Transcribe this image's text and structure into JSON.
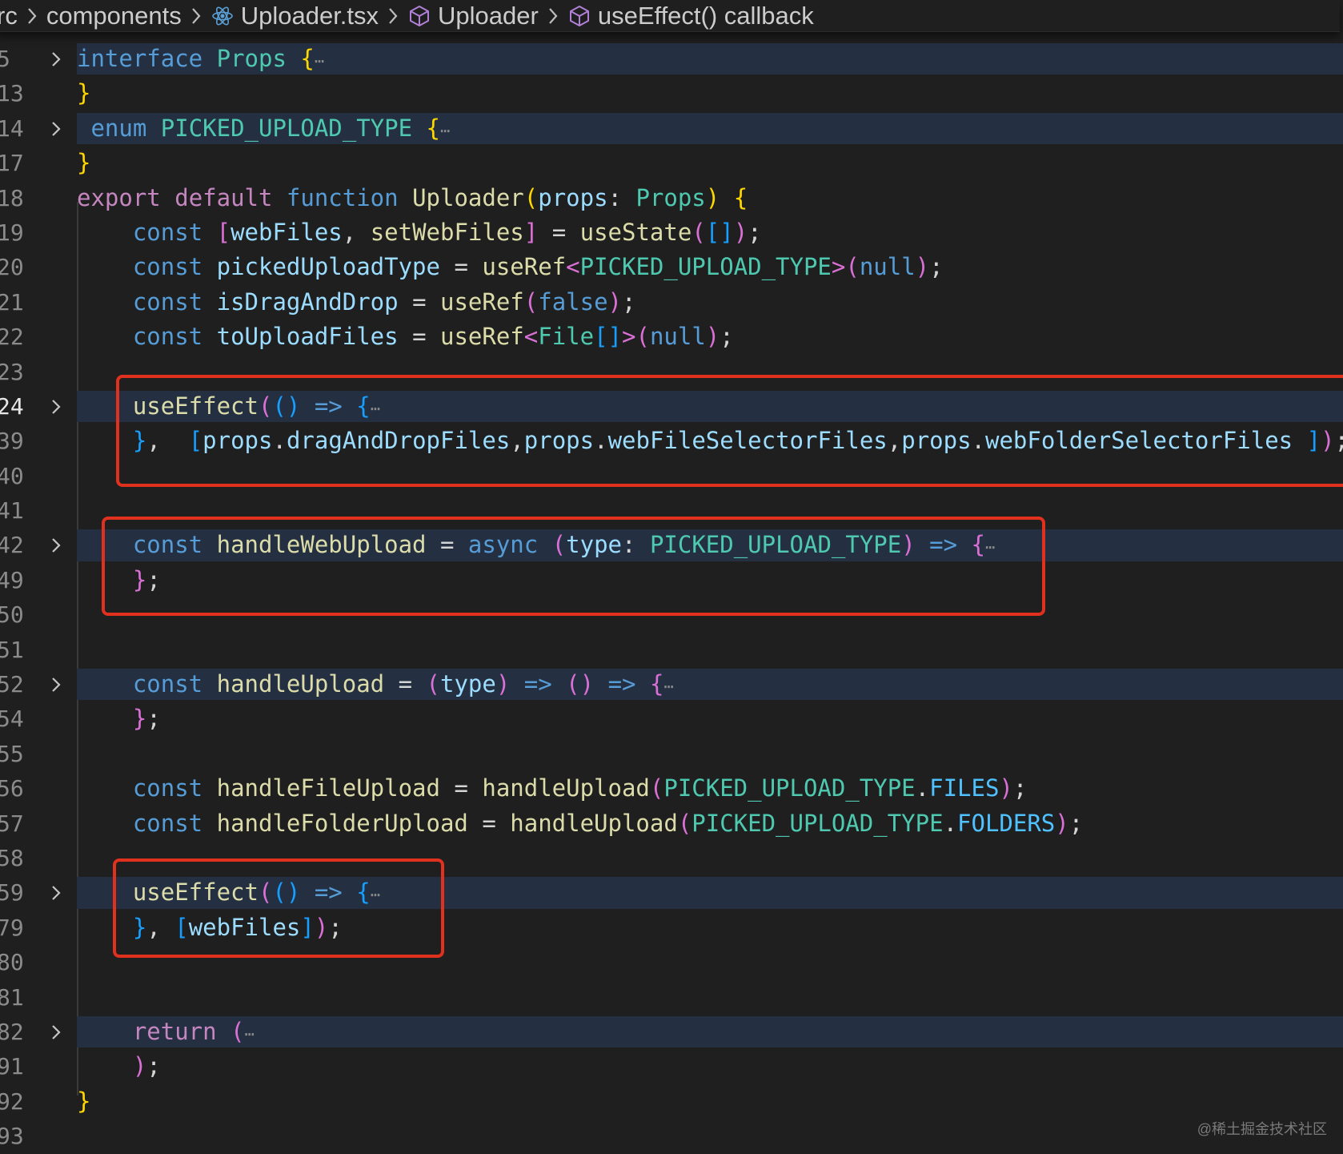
{
  "breadcrumb": {
    "items": [
      {
        "label": "rc",
        "icon": ""
      },
      {
        "label": "components",
        "icon": ""
      },
      {
        "label": "Uploader.tsx",
        "icon": "react-icon"
      },
      {
        "label": "Uploader",
        "icon": "cube-icon"
      },
      {
        "label": "useEffect() callback",
        "icon": "cube-icon"
      }
    ],
    "separator": ">"
  },
  "lines": [
    {
      "num": "5",
      "tokens": [
        [
          "interface",
          "k"
        ],
        [
          " ",
          ""
        ],
        [
          "Props",
          "t"
        ],
        [
          " ",
          ""
        ],
        [
          "{",
          "y"
        ],
        [
          "⋯",
          "dots"
        ]
      ],
      "fold": true,
      "hl": true
    },
    {
      "num": "13",
      "tokens": [
        [
          "}",
          "y"
        ]
      ]
    },
    {
      "num": "14",
      "tokens": [
        [
          " ",
          ""
        ],
        [
          "enum",
          "k"
        ],
        [
          " ",
          ""
        ],
        [
          "PICKED_UPLOAD_TYPE",
          "t"
        ],
        [
          " ",
          ""
        ],
        [
          "{",
          "y"
        ],
        [
          "⋯",
          "dots"
        ]
      ],
      "fold": true,
      "hl": true
    },
    {
      "num": "17",
      "tokens": [
        [
          "}",
          "y"
        ]
      ]
    },
    {
      "num": "18",
      "tokens": [
        [
          "export",
          "kc"
        ],
        [
          " ",
          ""
        ],
        [
          "default",
          "kc"
        ],
        [
          " ",
          ""
        ],
        [
          "function",
          "k"
        ],
        [
          " ",
          ""
        ],
        [
          "Uploader",
          "f"
        ],
        [
          "(",
          "y"
        ],
        [
          "props",
          "v"
        ],
        [
          ": ",
          ""
        ],
        [
          "Props",
          "t"
        ],
        [
          ")",
          "y"
        ],
        [
          " ",
          ""
        ],
        [
          "{",
          "y"
        ]
      ]
    },
    {
      "num": "19",
      "tokens": [
        [
          "    ",
          ""
        ],
        [
          "const",
          "k"
        ],
        [
          " ",
          ""
        ],
        [
          "[",
          "p"
        ],
        [
          "webFiles",
          "v"
        ],
        [
          ", ",
          ""
        ],
        [
          "setWebFiles",
          "f"
        ],
        [
          "]",
          "p"
        ],
        [
          " = ",
          ""
        ],
        [
          "useState",
          "f"
        ],
        [
          "(",
          "p"
        ],
        [
          "[]",
          "b"
        ],
        [
          ")",
          "p"
        ],
        [
          ";",
          ""
        ]
      ]
    },
    {
      "num": "20",
      "tokens": [
        [
          "    ",
          ""
        ],
        [
          "const",
          "k"
        ],
        [
          " ",
          ""
        ],
        [
          "pickedUploadType",
          "v"
        ],
        [
          " = ",
          ""
        ],
        [
          "useRef",
          "f"
        ],
        [
          "<",
          "p"
        ],
        [
          "PICKED_UPLOAD_TYPE",
          "t"
        ],
        [
          ">",
          "p"
        ],
        [
          "(",
          "p"
        ],
        [
          "null",
          "n"
        ],
        [
          ")",
          "p"
        ],
        [
          ";",
          ""
        ]
      ]
    },
    {
      "num": "21",
      "tokens": [
        [
          "    ",
          ""
        ],
        [
          "const",
          "k"
        ],
        [
          " ",
          ""
        ],
        [
          "isDragAndDrop",
          "v"
        ],
        [
          " = ",
          ""
        ],
        [
          "useRef",
          "f"
        ],
        [
          "(",
          "p"
        ],
        [
          "false",
          "n"
        ],
        [
          ")",
          "p"
        ],
        [
          ";",
          ""
        ]
      ]
    },
    {
      "num": "22",
      "tokens": [
        [
          "    ",
          ""
        ],
        [
          "const",
          "k"
        ],
        [
          " ",
          ""
        ],
        [
          "toUploadFiles",
          "v"
        ],
        [
          " = ",
          ""
        ],
        [
          "useRef",
          "f"
        ],
        [
          "<",
          "p"
        ],
        [
          "File",
          "t"
        ],
        [
          "[]",
          "b"
        ],
        [
          ">",
          "p"
        ],
        [
          "(",
          "p"
        ],
        [
          "null",
          "n"
        ],
        [
          ")",
          "p"
        ],
        [
          ";",
          ""
        ]
      ]
    },
    {
      "num": "23",
      "tokens": []
    },
    {
      "num": "24",
      "tokens": [
        [
          "    ",
          ""
        ],
        [
          "useEffect",
          "f"
        ],
        [
          "(",
          "p"
        ],
        [
          "()",
          "b"
        ],
        [
          " ",
          ""
        ],
        [
          "=>",
          "k"
        ],
        [
          " ",
          ""
        ],
        [
          "{",
          "b"
        ],
        [
          "⋯",
          "dots"
        ]
      ],
      "fold": true,
      "hl": true,
      "active": true
    },
    {
      "num": "39",
      "tokens": [
        [
          "    ",
          ""
        ],
        [
          "}",
          "b"
        ],
        [
          ",  ",
          ""
        ],
        [
          "[",
          "b"
        ],
        [
          "props",
          "v"
        ],
        [
          ".",
          ""
        ],
        [
          "dragAndDropFiles",
          "v"
        ],
        [
          ",",
          ""
        ],
        [
          "props",
          "v"
        ],
        [
          ".",
          ""
        ],
        [
          "webFileSelectorFiles",
          "v"
        ],
        [
          ",",
          ""
        ],
        [
          "props",
          "v"
        ],
        [
          ".",
          ""
        ],
        [
          "webFolderSelectorFiles",
          "v"
        ],
        [
          " ",
          ""
        ],
        [
          "]",
          "b"
        ],
        [
          ")",
          "p"
        ],
        [
          ";",
          ""
        ]
      ]
    },
    {
      "num": "40",
      "tokens": []
    },
    {
      "num": "41",
      "tokens": []
    },
    {
      "num": "42",
      "tokens": [
        [
          "    ",
          ""
        ],
        [
          "const",
          "k"
        ],
        [
          " ",
          ""
        ],
        [
          "handleWebUpload",
          "f"
        ],
        [
          " = ",
          ""
        ],
        [
          "async",
          "k"
        ],
        [
          " ",
          ""
        ],
        [
          "(",
          "p"
        ],
        [
          "type",
          "v"
        ],
        [
          ": ",
          ""
        ],
        [
          "PICKED_UPLOAD_TYPE",
          "t"
        ],
        [
          ")",
          "p"
        ],
        [
          " ",
          ""
        ],
        [
          "=>",
          "k"
        ],
        [
          " ",
          ""
        ],
        [
          "{",
          "p"
        ],
        [
          "⋯",
          "dots"
        ]
      ],
      "fold": true,
      "hl": true
    },
    {
      "num": "49",
      "tokens": [
        [
          "    ",
          ""
        ],
        [
          "}",
          "p"
        ],
        [
          ";",
          ""
        ]
      ]
    },
    {
      "num": "50",
      "tokens": []
    },
    {
      "num": "51",
      "tokens": []
    },
    {
      "num": "52",
      "tokens": [
        [
          "    ",
          ""
        ],
        [
          "const",
          "k"
        ],
        [
          " ",
          ""
        ],
        [
          "handleUpload",
          "f"
        ],
        [
          " = ",
          ""
        ],
        [
          "(",
          "p"
        ],
        [
          "type",
          "v"
        ],
        [
          ")",
          "p"
        ],
        [
          " ",
          ""
        ],
        [
          "=>",
          "k"
        ],
        [
          " ",
          ""
        ],
        [
          "()",
          "p"
        ],
        [
          " ",
          ""
        ],
        [
          "=>",
          "k"
        ],
        [
          " ",
          ""
        ],
        [
          "{",
          "p"
        ],
        [
          "⋯",
          "dots"
        ]
      ],
      "fold": true,
      "hl": true
    },
    {
      "num": "54",
      "tokens": [
        [
          "    ",
          ""
        ],
        [
          "}",
          "p"
        ],
        [
          ";",
          ""
        ]
      ]
    },
    {
      "num": "55",
      "tokens": []
    },
    {
      "num": "56",
      "tokens": [
        [
          "    ",
          ""
        ],
        [
          "const",
          "k"
        ],
        [
          " ",
          ""
        ],
        [
          "handleFileUpload",
          "f"
        ],
        [
          " = ",
          ""
        ],
        [
          "handleUpload",
          "f"
        ],
        [
          "(",
          "p"
        ],
        [
          "PICKED_UPLOAD_TYPE",
          "t"
        ],
        [
          ".",
          ""
        ],
        [
          "FILES",
          "e"
        ],
        [
          ")",
          "p"
        ],
        [
          ";",
          ""
        ]
      ]
    },
    {
      "num": "57",
      "tokens": [
        [
          "    ",
          ""
        ],
        [
          "const",
          "k"
        ],
        [
          " ",
          ""
        ],
        [
          "handleFolderUpload",
          "f"
        ],
        [
          " = ",
          ""
        ],
        [
          "handleUpload",
          "f"
        ],
        [
          "(",
          "p"
        ],
        [
          "PICKED_UPLOAD_TYPE",
          "t"
        ],
        [
          ".",
          ""
        ],
        [
          "FOLDERS",
          "e"
        ],
        [
          ")",
          "p"
        ],
        [
          ";",
          ""
        ]
      ]
    },
    {
      "num": "58",
      "tokens": []
    },
    {
      "num": "59",
      "tokens": [
        [
          "    ",
          ""
        ],
        [
          "useEffect",
          "f"
        ],
        [
          "(",
          "p"
        ],
        [
          "()",
          "b"
        ],
        [
          " ",
          ""
        ],
        [
          "=>",
          "k"
        ],
        [
          " ",
          ""
        ],
        [
          "{",
          "b"
        ],
        [
          "⋯",
          "dots"
        ]
      ],
      "fold": true,
      "hl": true
    },
    {
      "num": "79",
      "tokens": [
        [
          "    ",
          ""
        ],
        [
          "}",
          "b"
        ],
        [
          ", ",
          ""
        ],
        [
          "[",
          "b"
        ],
        [
          "webFiles",
          "v"
        ],
        [
          "]",
          "b"
        ],
        [
          ")",
          "p"
        ],
        [
          ";",
          ""
        ]
      ]
    },
    {
      "num": "80",
      "tokens": []
    },
    {
      "num": "81",
      "tokens": []
    },
    {
      "num": "82",
      "tokens": [
        [
          "    ",
          ""
        ],
        [
          "return",
          "kc"
        ],
        [
          " ",
          ""
        ],
        [
          "(",
          "p"
        ],
        [
          "⋯",
          "dots"
        ]
      ],
      "fold": true,
      "hl": true
    },
    {
      "num": "91",
      "tokens": [
        [
          "    ",
          ""
        ],
        [
          ")",
          "p"
        ],
        [
          ";",
          ""
        ]
      ]
    },
    {
      "num": "92",
      "tokens": [
        [
          "}",
          "y"
        ]
      ]
    },
    {
      "num": "93",
      "tokens": []
    }
  ],
  "watermark": "@稀土掘金技术社区"
}
